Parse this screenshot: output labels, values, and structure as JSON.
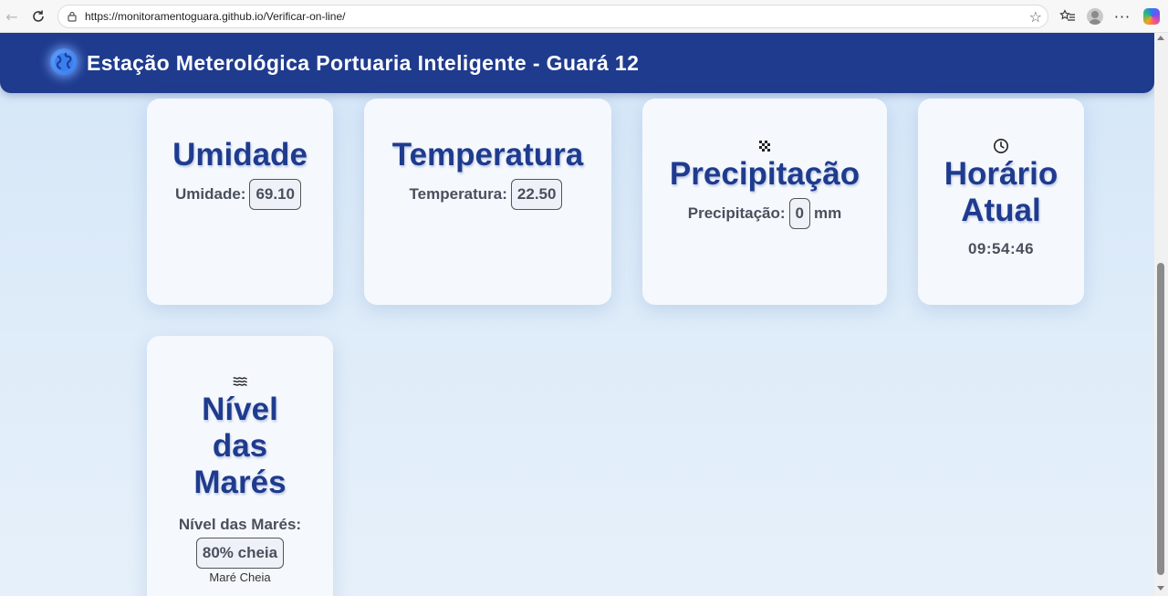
{
  "browser": {
    "url": "https://monitoramentoguara.github.io/Verificar-on-line/"
  },
  "header": {
    "title": "Estação Meterológica Portuaria Inteligente - Guará 12"
  },
  "cards": {
    "umidade": {
      "title": "Umidade",
      "label": "Umidade:",
      "value": "69.10"
    },
    "temperatura": {
      "title": "Temperatura",
      "label": "Temperatura:",
      "value": "22.50"
    },
    "precipitacao": {
      "title": "Precipitação",
      "label": "Precipitação:",
      "value": "0",
      "unit": "mm",
      "icon": "rain-icon"
    },
    "horario": {
      "title_line1": "Horário",
      "title_line2": "Atual",
      "time": "09:54:46",
      "icon": "clock-icon"
    },
    "mares": {
      "title_line1": "Nível",
      "title_line2": "das",
      "title_line3": "Marés",
      "label": "Nível das Marés:",
      "value": "80% cheia",
      "status": "Maré Cheia",
      "icon": "waves-icon"
    }
  },
  "colors": {
    "header_bg": "#1f3b8e",
    "title_color": "#1f3b8e",
    "page_bg": "#dceaf8"
  }
}
